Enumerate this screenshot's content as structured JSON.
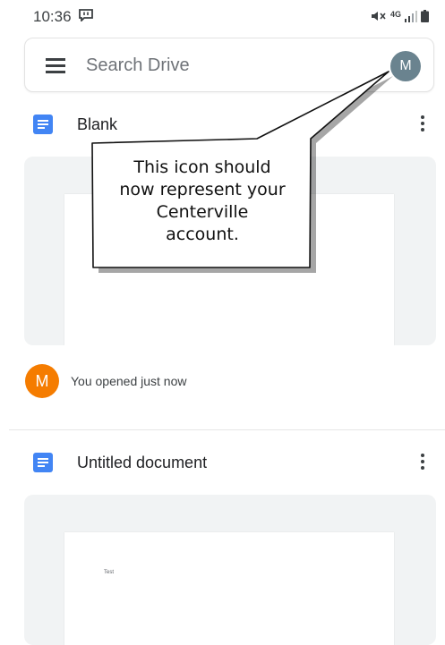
{
  "status_bar": {
    "time": "10:36",
    "network_label": "4G",
    "icons": [
      "message-icon",
      "mute-icon",
      "signal-icon",
      "battery-icon"
    ]
  },
  "search": {
    "placeholder": "Search Drive",
    "avatar_initial": "M",
    "avatar_color": "#6a838f"
  },
  "files": [
    {
      "title": "Blank",
      "icon": "docs-icon",
      "page_text": ""
    },
    {
      "title": "Untitled document",
      "icon": "docs-icon",
      "page_text": "Test"
    }
  ],
  "activity": {
    "avatar_initial": "M",
    "avatar_color": "#f57c00",
    "text": "You opened just now"
  },
  "callout": {
    "lines": [
      "This icon should",
      "now represent your",
      "Centerville",
      "account."
    ]
  },
  "colors": {
    "docs_blue": "#4285f4",
    "preview_bg": "#f1f3f4"
  }
}
